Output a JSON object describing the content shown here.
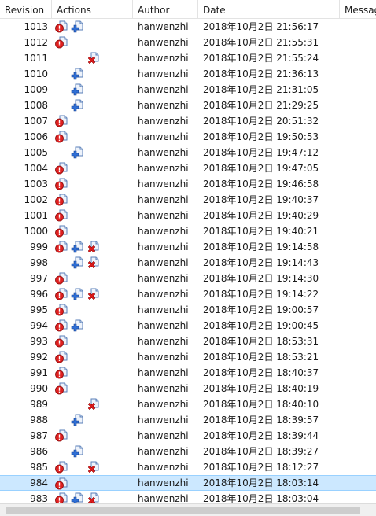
{
  "columns": {
    "revision": "Revision",
    "actions": "Actions",
    "author": "Author",
    "date": "Date",
    "message": "Messag"
  },
  "icons": {
    "modified": "modified-file-icon",
    "added": "added-file-icon",
    "deleted": "deleted-file-icon"
  },
  "colors": {
    "selected_row": "#cce8ff",
    "modified_red": "#e02020",
    "added_blue": "#2f6fd6",
    "deleted_red": "#d91a1a"
  },
  "rows": [
    {
      "rev": "1013",
      "mod": true,
      "add": true,
      "del": false,
      "author": "hanwenzhi",
      "date": "2018年10月2日 21:56:17"
    },
    {
      "rev": "1012",
      "mod": true,
      "add": false,
      "del": false,
      "author": "hanwenzhi",
      "date": "2018年10月2日 21:55:31"
    },
    {
      "rev": "1011",
      "mod": false,
      "add": false,
      "del": true,
      "author": "hanwenzhi",
      "date": "2018年10月2日 21:55:24"
    },
    {
      "rev": "1010",
      "mod": false,
      "add": true,
      "del": false,
      "author": "hanwenzhi",
      "date": "2018年10月2日 21:36:13"
    },
    {
      "rev": "1009",
      "mod": false,
      "add": true,
      "del": false,
      "author": "hanwenzhi",
      "date": "2018年10月2日 21:31:05"
    },
    {
      "rev": "1008",
      "mod": false,
      "add": true,
      "del": false,
      "author": "hanwenzhi",
      "date": "2018年10月2日 21:29:25"
    },
    {
      "rev": "1007",
      "mod": true,
      "add": false,
      "del": false,
      "author": "hanwenzhi",
      "date": "2018年10月2日 20:51:32"
    },
    {
      "rev": "1006",
      "mod": true,
      "add": false,
      "del": false,
      "author": "hanwenzhi",
      "date": "2018年10月2日 19:50:53"
    },
    {
      "rev": "1005",
      "mod": false,
      "add": true,
      "del": false,
      "author": "hanwenzhi",
      "date": "2018年10月2日 19:47:12"
    },
    {
      "rev": "1004",
      "mod": true,
      "add": false,
      "del": false,
      "author": "hanwenzhi",
      "date": "2018年10月2日 19:47:05"
    },
    {
      "rev": "1003",
      "mod": true,
      "add": false,
      "del": false,
      "author": "hanwenzhi",
      "date": "2018年10月2日 19:46:58"
    },
    {
      "rev": "1002",
      "mod": true,
      "add": false,
      "del": false,
      "author": "hanwenzhi",
      "date": "2018年10月2日 19:40:37"
    },
    {
      "rev": "1001",
      "mod": true,
      "add": false,
      "del": false,
      "author": "hanwenzhi",
      "date": "2018年10月2日 19:40:29"
    },
    {
      "rev": "1000",
      "mod": true,
      "add": false,
      "del": false,
      "author": "hanwenzhi",
      "date": "2018年10月2日 19:40:21"
    },
    {
      "rev": "999",
      "mod": true,
      "add": true,
      "del": true,
      "author": "hanwenzhi",
      "date": "2018年10月2日 19:14:58"
    },
    {
      "rev": "998",
      "mod": false,
      "add": true,
      "del": true,
      "author": "hanwenzhi",
      "date": "2018年10月2日 19:14:43"
    },
    {
      "rev": "997",
      "mod": true,
      "add": false,
      "del": false,
      "author": "hanwenzhi",
      "date": "2018年10月2日 19:14:30"
    },
    {
      "rev": "996",
      "mod": true,
      "add": true,
      "del": true,
      "author": "hanwenzhi",
      "date": "2018年10月2日 19:14:22"
    },
    {
      "rev": "995",
      "mod": true,
      "add": false,
      "del": false,
      "author": "hanwenzhi",
      "date": "2018年10月2日 19:00:57"
    },
    {
      "rev": "994",
      "mod": true,
      "add": true,
      "del": false,
      "author": "hanwenzhi",
      "date": "2018年10月2日 19:00:45"
    },
    {
      "rev": "993",
      "mod": true,
      "add": false,
      "del": false,
      "author": "hanwenzhi",
      "date": "2018年10月2日 18:53:31"
    },
    {
      "rev": "992",
      "mod": true,
      "add": false,
      "del": false,
      "author": "hanwenzhi",
      "date": "2018年10月2日 18:53:21"
    },
    {
      "rev": "991",
      "mod": true,
      "add": false,
      "del": false,
      "author": "hanwenzhi",
      "date": "2018年10月2日 18:40:37"
    },
    {
      "rev": "990",
      "mod": true,
      "add": false,
      "del": false,
      "author": "hanwenzhi",
      "date": "2018年10月2日 18:40:19"
    },
    {
      "rev": "989",
      "mod": false,
      "add": false,
      "del": true,
      "author": "hanwenzhi",
      "date": "2018年10月2日 18:40:10"
    },
    {
      "rev": "988",
      "mod": false,
      "add": true,
      "del": false,
      "author": "hanwenzhi",
      "date": "2018年10月2日 18:39:57"
    },
    {
      "rev": "987",
      "mod": true,
      "add": false,
      "del": false,
      "author": "hanwenzhi",
      "date": "2018年10月2日 18:39:44"
    },
    {
      "rev": "986",
      "mod": false,
      "add": true,
      "del": false,
      "author": "hanwenzhi",
      "date": "2018年10月2日 18:39:27"
    },
    {
      "rev": "985",
      "mod": true,
      "add": false,
      "del": true,
      "author": "hanwenzhi",
      "date": "2018年10月2日 18:12:27"
    },
    {
      "rev": "984",
      "mod": true,
      "add": false,
      "del": false,
      "author": "hanwenzhi",
      "date": "2018年10月2日 18:03:14",
      "selected": true
    },
    {
      "rev": "983",
      "mod": true,
      "add": true,
      "del": true,
      "author": "hanwenzhi",
      "date": "2018年10月2日 18:03:04"
    }
  ]
}
